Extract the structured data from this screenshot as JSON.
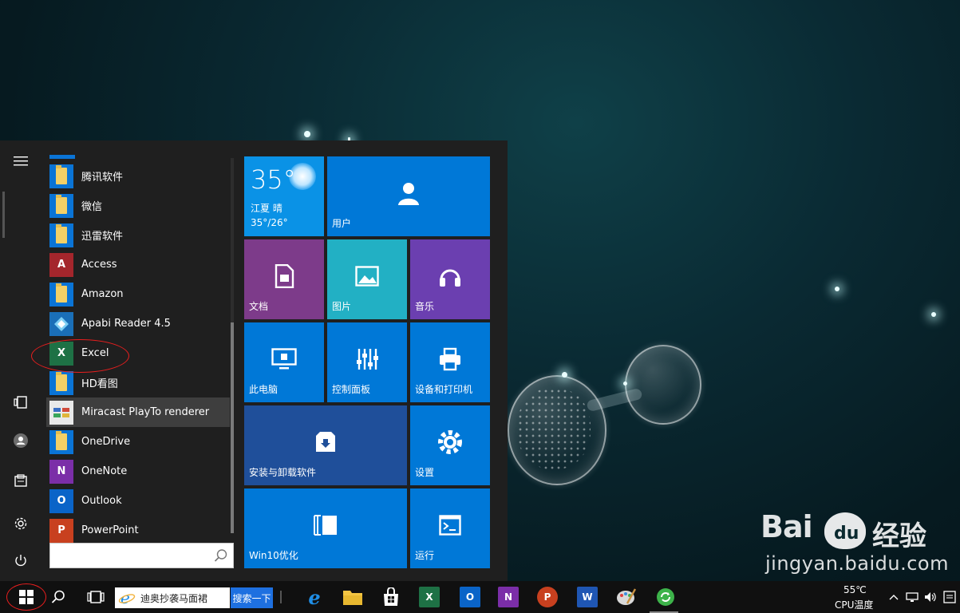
{
  "start_menu": {
    "apps": [
      {
        "label": "腾讯软件",
        "icon": "folder-icon"
      },
      {
        "label": "微信",
        "icon": "folder-icon"
      },
      {
        "label": "迅雷软件",
        "icon": "folder-icon"
      },
      {
        "label": "Access",
        "icon": "access-icon",
        "glyph": "A"
      },
      {
        "label": "Amazon",
        "icon": "folder-icon"
      },
      {
        "label": "Apabi Reader 4.5",
        "icon": "apabi-reader-icon"
      },
      {
        "label": "Excel",
        "icon": "excel-icon",
        "glyph": "X"
      },
      {
        "label": "HD看图",
        "icon": "folder-icon"
      },
      {
        "label": "Miracast PlayTo renderer",
        "icon": "miracast-icon"
      },
      {
        "label": "OneDrive",
        "icon": "folder-icon"
      },
      {
        "label": "OneNote",
        "icon": "onenote-icon",
        "glyph": "N"
      },
      {
        "label": "Outlook",
        "icon": "outlook-icon",
        "glyph": "O"
      },
      {
        "label": "PowerPoint",
        "icon": "powerpoint-icon",
        "glyph": "P"
      }
    ],
    "search": {
      "value": ""
    },
    "tiles": {
      "weather": {
        "temp": "35°",
        "location": "江夏  晴",
        "range": "35°/26°"
      },
      "user": "用户",
      "documents": "文档",
      "pictures": "图片",
      "music": "音乐",
      "this_pc": "此电脑",
      "control_panel": "控制面板",
      "devices_printers": "设备和打印机",
      "install_uninstall": "安装与卸载软件",
      "settings": "设置",
      "win10_optimize": "Win10优化",
      "run": "运行"
    }
  },
  "taskbar": {
    "search_field": "迪奥抄袭马面裙",
    "search_button": "搜索一下",
    "cpu_temp": "55℃",
    "cpu_label": "CPU温度",
    "pinned": [
      {
        "name": "edge-icon",
        "glyph": "e",
        "color": "#1f8ee6"
      },
      {
        "name": "file-explorer-icon",
        "glyph": "",
        "color": "#f4c542"
      },
      {
        "name": "store-icon",
        "glyph": "",
        "color": "#ffffff"
      },
      {
        "name": "excel-icon",
        "glyph": "X",
        "color": "#1e7145"
      },
      {
        "name": "outlook-icon",
        "glyph": "O",
        "color": "#0a64c8"
      },
      {
        "name": "onenote-icon",
        "glyph": "N",
        "color": "#7b2ea8"
      },
      {
        "name": "powerpoint-icon",
        "glyph": "P",
        "color": "#c8401f"
      },
      {
        "name": "word-icon",
        "glyph": "W",
        "color": "#1f56b3"
      },
      {
        "name": "paint-icon",
        "glyph": "",
        "color": "#d9d9d9"
      },
      {
        "name": "refresh-app-icon",
        "glyph": "",
        "color": "#3db34a"
      }
    ]
  },
  "watermark": {
    "brand": "Bai",
    "brand_du": "du",
    "brand_cn": "经验",
    "url": "jingyan.baidu.com"
  },
  "colors": {
    "tile_blue": "#0078d7",
    "tile_purple": "#7d3b8a",
    "tile_teal": "#22b0c4",
    "tile_violet": "#6b3fb0",
    "tile_navy": "#1f4f9a",
    "annotation_red": "#e81e1e"
  }
}
